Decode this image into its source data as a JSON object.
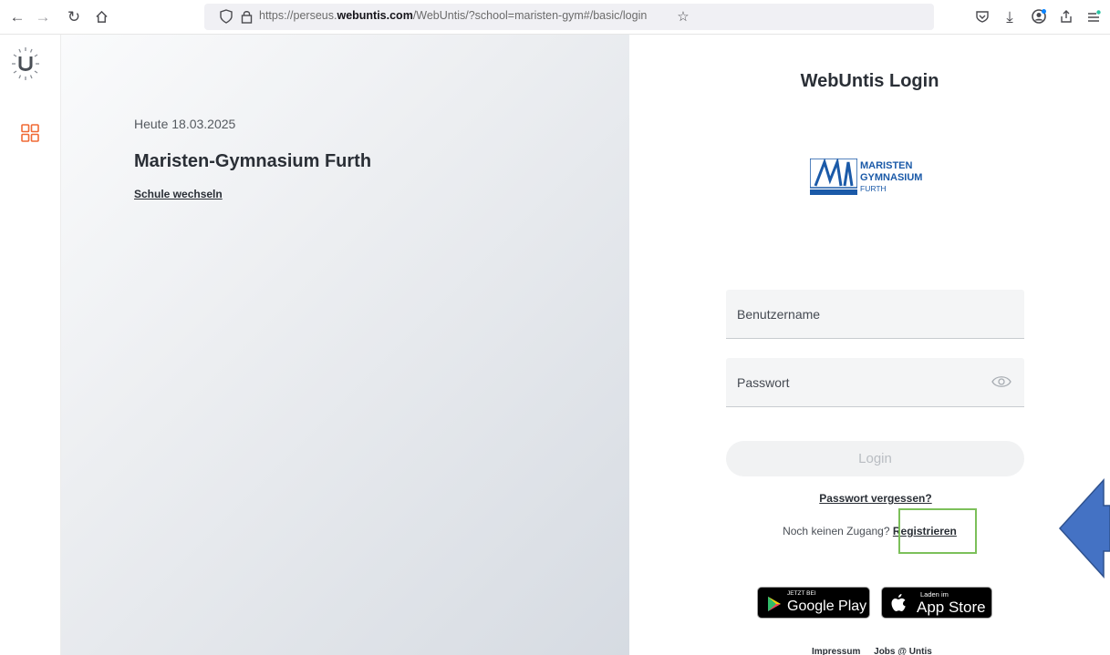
{
  "browser": {
    "url_prefix": "https://perseus.",
    "url_domain": "webuntis.com",
    "url_path": "/WebUntis/?school=maristen-gym#/basic/login"
  },
  "panel": {
    "date_label": "Heute 18.03.2025",
    "school_name": "Maristen-Gymnasium Furth",
    "switch_school": "Schule wechseln"
  },
  "login": {
    "title": "WebUntis Login",
    "username_placeholder": "Benutzername",
    "password_placeholder": "Passwort",
    "login_button": "Login",
    "forgot_password": "Passwort vergessen?",
    "no_access_text": "Noch keinen Zugang?",
    "register_link": "Registrieren"
  },
  "school_logo": {
    "line1": "MARISTEN",
    "line2": "GYMNASIUM",
    "line3": "FURTH"
  },
  "stores": {
    "google_small": "JETZT BEI",
    "google_big": "Google Play",
    "apple_small": "Laden im",
    "apple_big": "App Store"
  },
  "footer": {
    "impressum": "Impressum",
    "jobs": "Jobs @ Untis"
  },
  "colors": {
    "accent": "#f06a35",
    "logo_blue": "#1b5aa8",
    "highlight": "#7cc05a",
    "arrow": "#4472c4"
  }
}
